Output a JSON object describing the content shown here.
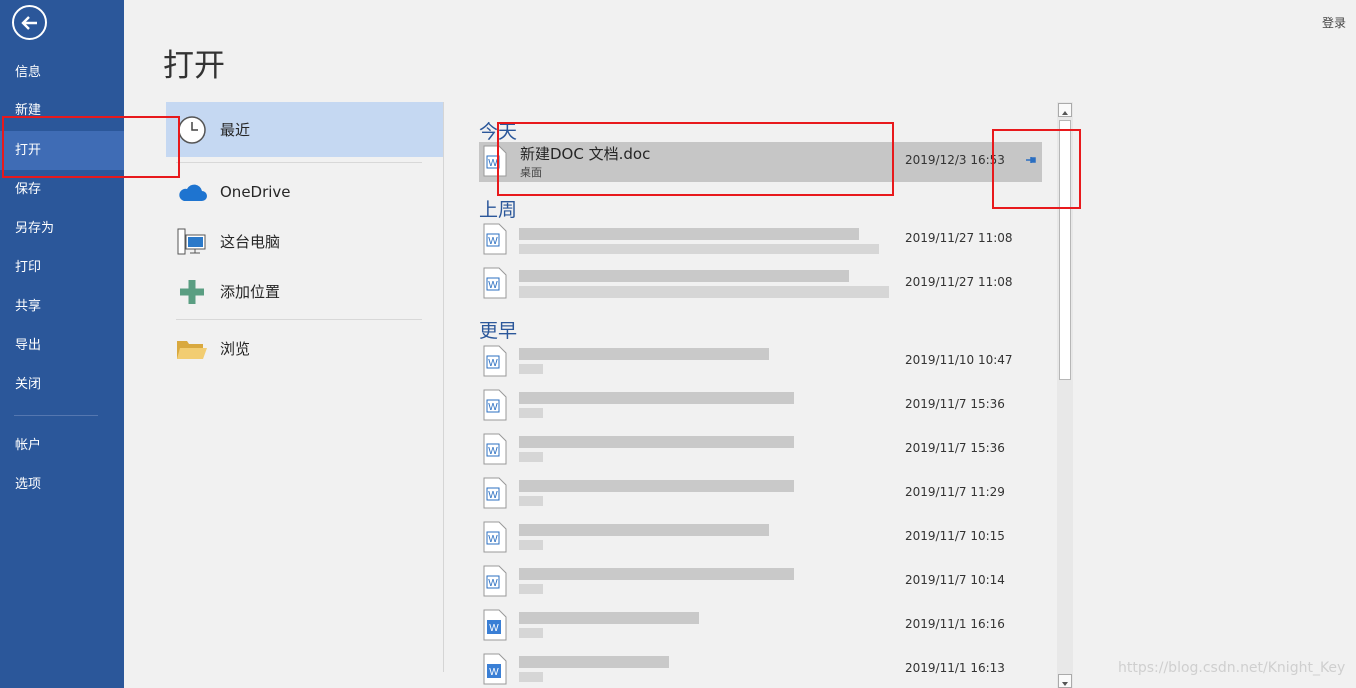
{
  "nav": {
    "items": [
      "信息",
      "新建",
      "打开",
      "保存",
      "另存为",
      "打印",
      "共享",
      "导出",
      "关闭",
      "帐户",
      "选项"
    ]
  },
  "header": {
    "sign_in": "登录",
    "title": "打开"
  },
  "locations": {
    "recent": "最近",
    "onedrive": "OneDrive",
    "this_pc": "这台电脑",
    "add_place": "添加位置",
    "browse": "浏览"
  },
  "groups": {
    "today": "今天",
    "last_week": "上周",
    "older": "更早"
  },
  "files": {
    "today": [
      {
        "name": "新建DOC 文档.doc",
        "path": "桌面",
        "date": "2019/12/3 16:53"
      }
    ],
    "last_week": [
      {
        "date": "2019/11/27 11:08"
      },
      {
        "date": "2019/11/27 11:08"
      }
    ],
    "older": [
      {
        "date": "2019/11/10 10:47"
      },
      {
        "date": "2019/11/7 15:36"
      },
      {
        "date": "2019/11/7 15:36"
      },
      {
        "date": "2019/11/7 11:29"
      },
      {
        "date": "2019/11/7 10:15"
      },
      {
        "date": "2019/11/7 10:14"
      },
      {
        "date": "2019/11/1 16:16"
      },
      {
        "date": "2019/11/1 16:13"
      }
    ]
  },
  "watermark": "https://blog.csdn.net/Knight_Key",
  "colors": {
    "nav_bg": "#2b579a",
    "accent": "#2b579a",
    "highlight": "#e8191c"
  }
}
